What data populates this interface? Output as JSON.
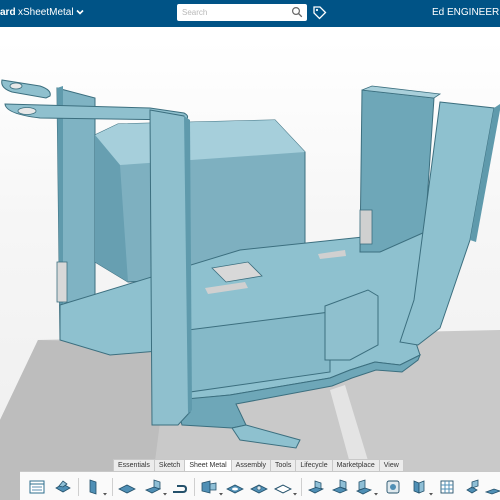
{
  "header": {
    "brand_fragment": "ard",
    "app_name": "xSheetMetal",
    "user_name": "Ed ENGINEER"
  },
  "search": {
    "placeholder": "Search"
  },
  "action_bar": {
    "tabs": [
      {
        "label": "Essentials",
        "active": false
      },
      {
        "label": "Sketch",
        "active": false
      },
      {
        "label": "Sheet Metal",
        "active": true
      },
      {
        "label": "Assembly",
        "active": false
      },
      {
        "label": "Tools",
        "active": false
      },
      {
        "label": "Lifecycle",
        "active": false
      },
      {
        "label": "Marketplace",
        "active": false
      },
      {
        "label": "View",
        "active": false
      }
    ],
    "tools": [
      "properties-panel-icon",
      "sheet-metal-part-icon",
      "wall-icon",
      "bend-icon",
      "flange-icon",
      "hem-icon",
      "tab-icon",
      "cutout-icon",
      "punch-icon",
      "bead-icon",
      "louver-icon",
      "corner-relief-icon",
      "unfold-icon",
      "stamp-icon",
      "weld-icon",
      "mirror-icon",
      "pattern-icon",
      "flatten-icon"
    ]
  },
  "colors": {
    "header_bg": "#005386",
    "metal": "#8fc0ce",
    "metal_dark": "#5f9aac",
    "metal_edge": "#3c6f7f",
    "floor": "#c8c8c8"
  }
}
